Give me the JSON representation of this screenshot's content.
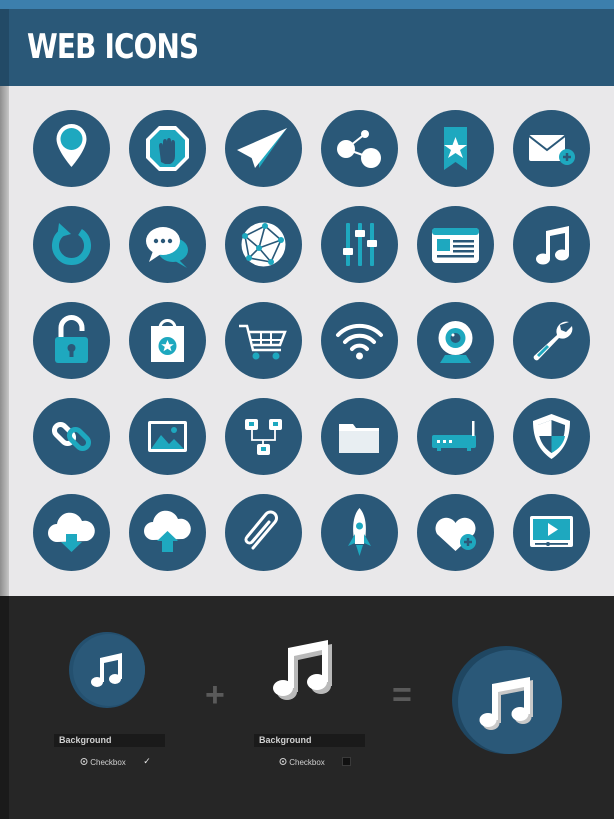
{
  "header": {
    "title": "WEB ICONS"
  },
  "colors": {
    "circle": "#2a5878",
    "accent": "#1ea8bf",
    "white": "#ffffff",
    "header": "#2a5878",
    "header_top": "#3c7fad",
    "panel_bg": "#e9e8ea",
    "bottom_bg": "#262626"
  },
  "icons": [
    [
      "map-pin-icon",
      "stop-hand-icon",
      "paper-plane-icon",
      "share-icon",
      "bookmark-star-icon",
      "mail-add-icon"
    ],
    [
      "refresh-icon",
      "chat-bubbles-icon",
      "globe-network-icon",
      "sliders-icon",
      "browser-window-icon",
      "music-note-icon"
    ],
    [
      "padlock-icon",
      "shopping-bag-star-icon",
      "shopping-cart-icon",
      "wifi-icon",
      "webcam-icon",
      "wrench-icon"
    ],
    [
      "link-icon",
      "image-icon",
      "network-nodes-icon",
      "folder-icon",
      "router-icon",
      "shield-icon"
    ],
    [
      "cloud-download-icon",
      "cloud-upload-icon",
      "paperclip-icon",
      "rocket-icon",
      "heart-add-icon",
      "video-player-icon"
    ]
  ],
  "demo": {
    "plus": "+",
    "equals": "=",
    "layer1": {
      "label": "Background",
      "checkbox_label": "Checkbox",
      "checked": true,
      "check_mark": "✓"
    },
    "layer2": {
      "label": "Background",
      "checkbox_label": "Checkbox",
      "checked": false
    }
  }
}
